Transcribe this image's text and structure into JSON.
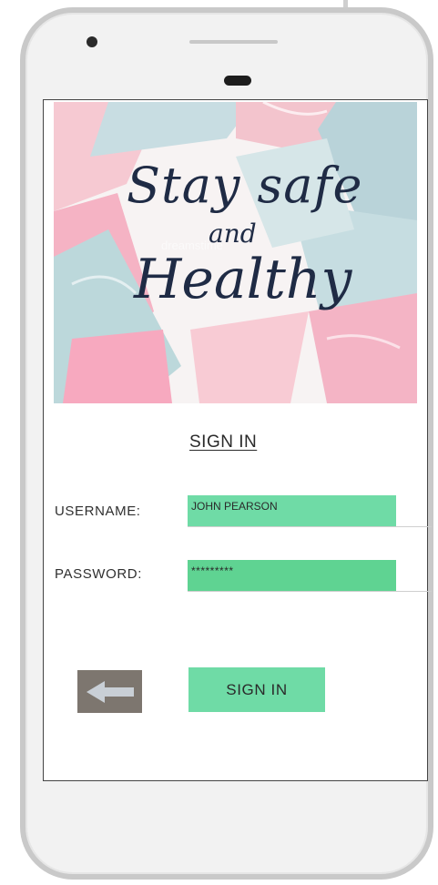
{
  "hero": {
    "line1": "Stay safe",
    "line2": "and",
    "line3": "Healthy",
    "watermark": "dreamstime"
  },
  "form": {
    "title": "SIGN IN",
    "username_label": "USERNAME:",
    "username_value": "JOHN PEARSON",
    "password_label": "PASSWORD:",
    "password_value": "*********"
  },
  "actions": {
    "back_icon": "left-arrow-icon",
    "signin_label": "SIGN IN"
  },
  "colors": {
    "accent_green": "#6fdba6",
    "back_button": "#7d766f",
    "script_text": "#1f2b45"
  }
}
